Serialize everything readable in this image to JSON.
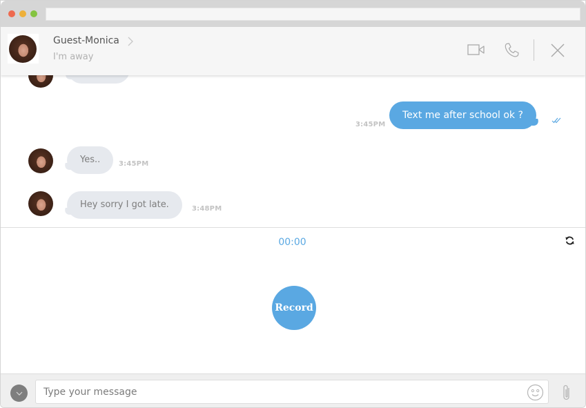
{
  "window": {
    "traffic_lights": [
      "close",
      "minimize",
      "maximize"
    ],
    "address_bar_value": ""
  },
  "header": {
    "contact_name": "Guest-Monica",
    "contact_status": "I'm away",
    "icons": [
      "video-camera-icon",
      "phone-icon",
      "close-icon"
    ]
  },
  "messages": [
    {
      "direction": "incoming",
      "text": "",
      "time": "",
      "partial": true
    },
    {
      "direction": "outgoing",
      "text": "Text me after school ok ?",
      "time": "3:45PM",
      "read": true
    },
    {
      "direction": "incoming",
      "text": "Yes..",
      "time": "3:45PM"
    },
    {
      "direction": "incoming",
      "text": "Hey sorry I got late.",
      "time": "3:48PM"
    }
  ],
  "recorder": {
    "timer": "00:00",
    "record_label": "Record"
  },
  "composer": {
    "placeholder": "Type your message",
    "value": ""
  },
  "colors": {
    "accent": "#5aa8e2",
    "incoming_bubble": "#e6e9ee",
    "header_bg": "#f6f6f6",
    "composer_bg": "#efefef"
  }
}
